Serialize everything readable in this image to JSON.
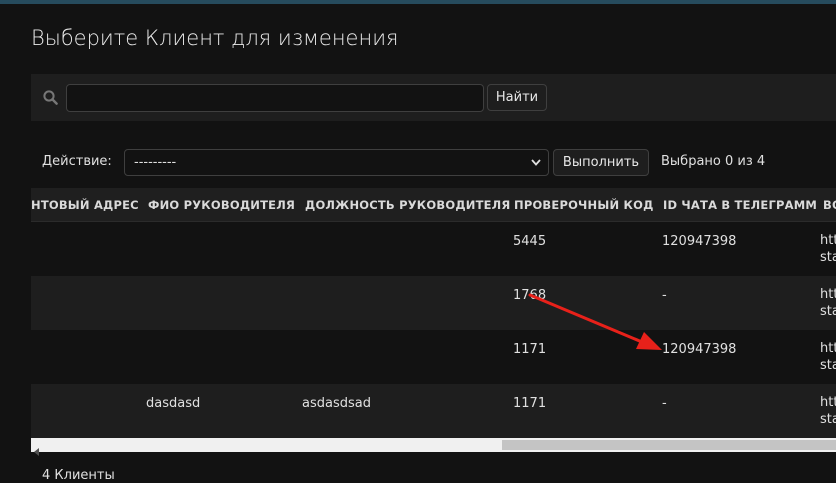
{
  "title": "Выберите Клиент для изменения",
  "search": {
    "value": "",
    "placeholder": "",
    "button_label": "Найти"
  },
  "actions": {
    "label": "Действие:",
    "selected": "---------",
    "go_label": "Выполнить",
    "counter": "Выбрано 0 из 4"
  },
  "table": {
    "columns": [
      "НТОВЫЙ АДРЕС",
      "ФИО РУКОВОДИТЕЛЯ",
      "ДОЛЖНОСТЬ РУКОВОДИТЕЛЯ",
      "ПРОВЕРОЧНЫЙ КОД",
      "ID ЧАТА В ТЕЛЕГРАММ",
      "ВО"
    ],
    "rows": [
      {
        "address": "",
        "head_name": "",
        "head_position": "",
        "code": "5445",
        "chat_id": "120947398",
        "link_1": "htt",
        "link_2": "sta"
      },
      {
        "address": "",
        "head_name": "",
        "head_position": "",
        "code": "1768",
        "chat_id": "-",
        "link_1": "htt",
        "link_2": "sta"
      },
      {
        "address": "",
        "head_name": "",
        "head_position": "",
        "code": "1171",
        "chat_id": "120947398",
        "link_1": "htt",
        "link_2": "sta"
      },
      {
        "address": "",
        "head_name": "dasdasd",
        "head_position": "asdasdsad",
        "code": "1171",
        "chat_id": "-",
        "link_1": "htt",
        "link_2": "sta"
      }
    ]
  },
  "footer": "4 Клиенты",
  "colors": {
    "background": "#121212",
    "topbar": "#264b5d",
    "annotation_arrow": "#e8211a"
  },
  "icons": {
    "search": "search-icon",
    "select": "chevron-down-icon",
    "scroll_left": "scroll-left-arrow-icon"
  }
}
